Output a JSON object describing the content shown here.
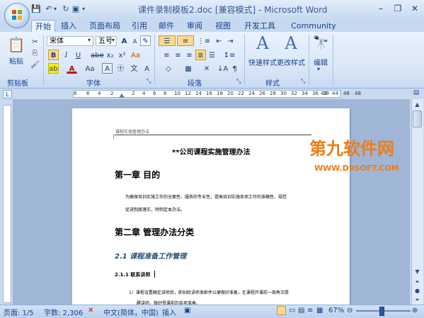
{
  "window": {
    "title": "课件录制模板2.doc [兼容模式] - Microsoft Word",
    "minimize": "–",
    "restore": "❐",
    "close": "✕"
  },
  "tabs": [
    "开始",
    "插入",
    "页面布局",
    "引用",
    "邮件",
    "审阅",
    "视图",
    "开发工具",
    "Community Clips"
  ],
  "ribbon": {
    "clipboard": {
      "paste": "粘贴",
      "label": "剪贴板"
    },
    "font": {
      "name": "宋体",
      "size": "五号",
      "label": "字体"
    },
    "paragraph": {
      "label": "段落"
    },
    "styles": {
      "quick": "快速样式",
      "change": "更改样式",
      "label": "样式"
    },
    "editing": {
      "label": "编辑"
    }
  },
  "ruler": {
    "left_nums": [
      "8",
      "6",
      "4",
      "2"
    ],
    "right_nums": [
      "2",
      "4",
      "6",
      "8",
      "10",
      "12",
      "14",
      "16",
      "18",
      "20",
      "22",
      "24",
      "26",
      "28",
      "30",
      "32",
      "34",
      "36",
      "38"
    ],
    "far_nums": [
      "42",
      "44",
      "46",
      "48"
    ]
  },
  "document": {
    "header_text": "课程实施管理办法",
    "title": "**公司课程实施管理办法",
    "ch1": "第一章  目的",
    "p1a": "为确保培训实施工作的全面性、服务的专业性，提高培训实施各项工作的准确性，规范",
    "p1b": "促进制度落实，特制定本办法。",
    "ch2": "第二章  管理办法分类",
    "s21": "2.1 课程准备工作管理",
    "s211": "2.1.1    联系讲师",
    "li1a": "1）课程设置确定讲师后，即刻给讲师发邮件以便做好准备，在课程开课前一周再次提",
    "li1b": "醒讲师，做好授课前的各项准备。"
  },
  "watermark": {
    "line1": "第九软件网",
    "line2": "WWW.D9SOFT.COM"
  },
  "status": {
    "page": "页面: 1/5",
    "words": "字数: 2,306",
    "lang": "中文(简体，中国)",
    "insert": "插入",
    "zoom": "67%"
  }
}
